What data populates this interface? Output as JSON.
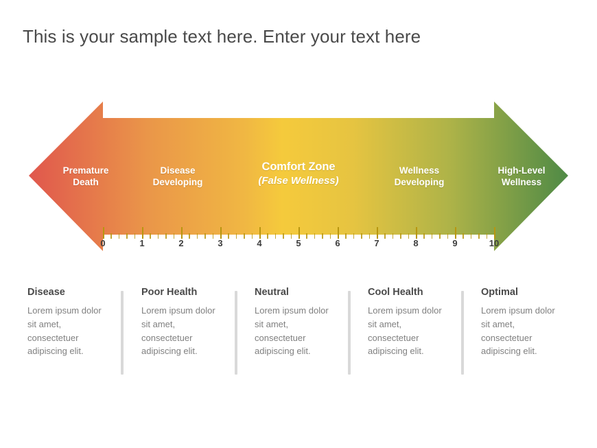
{
  "title": "This is your sample text here. Enter your text here",
  "arrow": {
    "direction": "bidirectional-horizontal",
    "gradient_stops": [
      {
        "pos": 0,
        "color": "#e0574d"
      },
      {
        "pos": 22,
        "color": "#ea9649"
      },
      {
        "pos": 47,
        "color": "#f5ca3c"
      },
      {
        "pos": 60,
        "color": "#ecc93f"
      },
      {
        "pos": 78,
        "color": "#aeb348"
      },
      {
        "pos": 100,
        "color": "#4f8a46"
      }
    ],
    "segments": [
      {
        "primary": "Premature",
        "secondary": "Death",
        "highlight": false,
        "center_pct": 12.5
      },
      {
        "primary": "Disease",
        "secondary": "Developing",
        "highlight": false,
        "center_pct": 29.8
      },
      {
        "primary": "Comfort Zone",
        "secondary": "(False Wellness)",
        "highlight": true,
        "center_pct": 50.0
      },
      {
        "primary": "Wellness",
        "secondary": "Developing",
        "highlight": false,
        "center_pct": 70.2
      },
      {
        "primary": "High-Level",
        "secondary": "Wellness",
        "highlight": false,
        "center_pct": 87.4
      }
    ]
  },
  "ruler": {
    "min": 0,
    "max": 10,
    "major_labels": [
      "0",
      "1",
      "2",
      "3",
      "4",
      "5",
      "6",
      "7",
      "8",
      "9",
      "10"
    ],
    "minor_ticks_per_unit": 5,
    "tick_color": "#b8960f",
    "label_color": "#3d3d3d"
  },
  "details": {
    "columns": [
      {
        "heading": "Disease",
        "body": "Lorem ipsum dolor sit amet, consectetuer adipiscing elit."
      },
      {
        "heading": "Poor Health",
        "body": "Lorem ipsum dolor sit amet, consectetuer adipiscing elit."
      },
      {
        "heading": "Neutral",
        "body": "Lorem ipsum dolor sit amet, consectetuer adipiscing elit."
      },
      {
        "heading": "Cool Health",
        "body": "Lorem ipsum dolor sit amet, consectetuer adipiscing elit."
      },
      {
        "heading": "Optimal",
        "body": "Lorem ipsum dolor sit amet, consectetuer adipiscing elit."
      }
    ],
    "divider_color": "#d9d9d9"
  }
}
